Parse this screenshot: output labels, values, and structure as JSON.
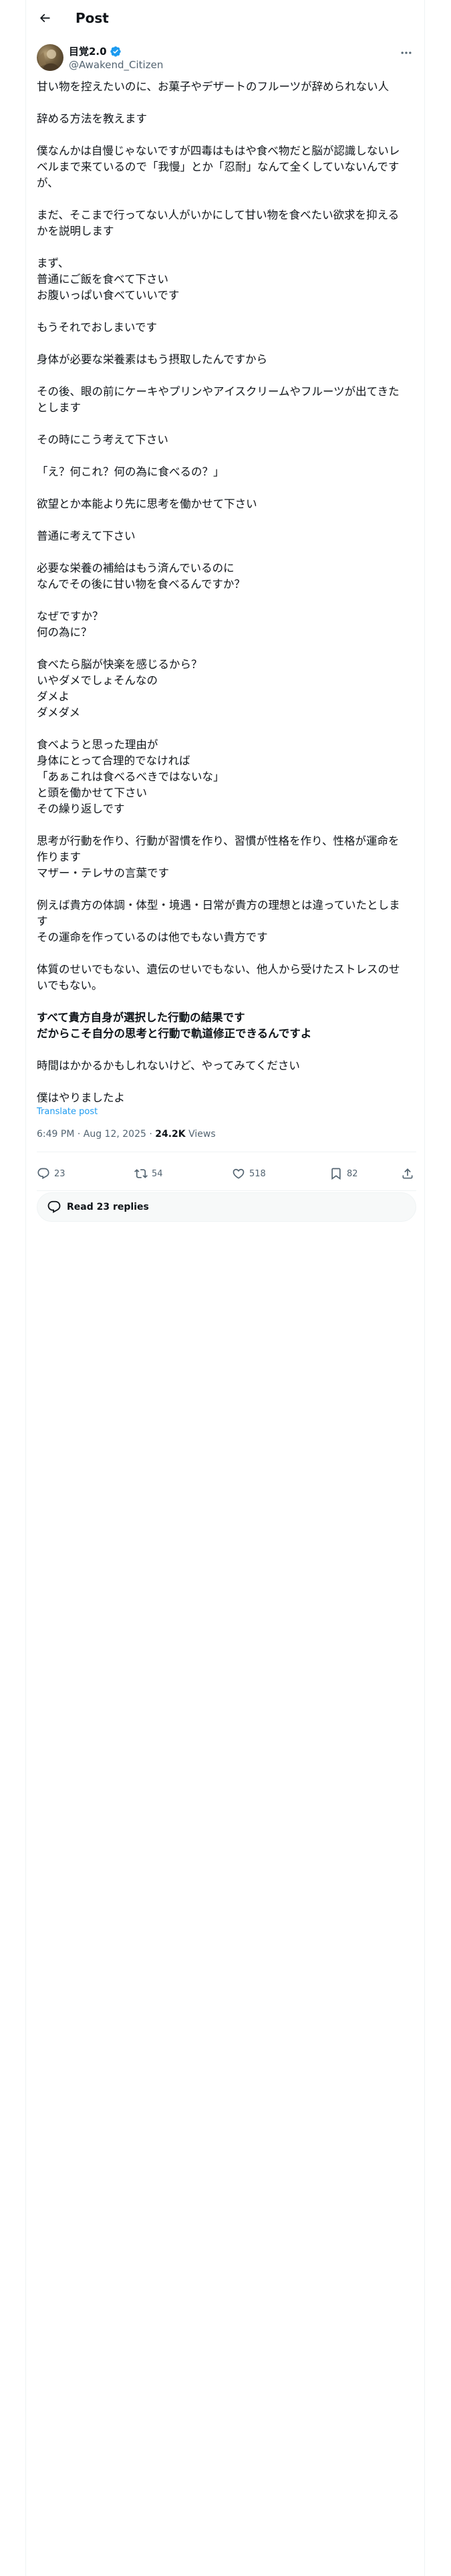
{
  "header": {
    "title": "Post"
  },
  "author": {
    "name": "目覚2.0",
    "handle": "@Awakend_Citizen"
  },
  "post": {
    "paragraphs": [
      {
        "lines": [
          "甘い物を控えたいのに、お菓子やデザートのフルーツが辞められない人"
        ]
      },
      {
        "lines": [
          "辞める方法を教えます"
        ]
      },
      {
        "lines": [
          "僕なんかは自慢じゃないですが四毒はもはや食べ物だと脳が認識しないレ",
          "ベルまで来ているので「我慢」とか「忍耐」なんて全くしていないんです",
          "が、"
        ]
      },
      {
        "lines": [
          "まだ、そこまで行ってない人がいかにして甘い物を食べたい欲求を抑える",
          "かを説明します"
        ]
      },
      {
        "lines": [
          "まず、",
          "普通にご飯を食べて下さい",
          "お腹いっぱい食べていいです"
        ]
      },
      {
        "lines": [
          "もうそれでおしまいです"
        ]
      },
      {
        "lines": [
          "身体が必要な栄養素はもう摂取したんですから"
        ]
      },
      {
        "lines": [
          "その後、眼の前にケーキやプリンやアイスクリームやフルーツが出てきた",
          "とします"
        ]
      },
      {
        "lines": [
          "その時にこう考えて下さい"
        ]
      },
      {
        "lines": [
          "「え？何これ？何の為に食べるの？」"
        ]
      },
      {
        "lines": [
          "欲望とか本能より先に思考を働かせて下さい"
        ]
      },
      {
        "lines": [
          "普通に考えて下さい"
        ]
      },
      {
        "lines": [
          "必要な栄養の補給はもう済んでいるのに",
          "なんでその後に甘い物を食べるんですか？"
        ]
      },
      {
        "lines": [
          "なぜですか？",
          "何の為に？"
        ]
      },
      {
        "lines": [
          "食べたら脳が快楽を感じるから？",
          "いやダメでしょそんなの",
          "ダメよ",
          "ダメダメ"
        ]
      },
      {
        "lines": [
          "食べようと思った理由が",
          "身体にとって合理的でなければ",
          "「あぁこれは食べるべきではないな」",
          "と頭を働かせて下さい",
          "その繰り返しです"
        ]
      },
      {
        "lines": [
          "思考が行動を作り、行動が習慣を作り、習慣が性格を作り、性格が運命を",
          "作ります",
          "マザー・テレサの言葉です"
        ]
      },
      {
        "lines": [
          "例えば貴方の体調・体型・境遇・日常が貴方の理想とは違っていたとしま",
          "す",
          "その運命を作っているのは他でもない貴方です"
        ]
      },
      {
        "lines": [
          "体質のせいでもない、遺伝のせいでもない、他人から受けたストレスのせ",
          "いでもない。"
        ]
      },
      {
        "lines": [
          "すべて貴方自身が選択した行動の結果です",
          "だからこそ自分の思考と行動で軌道修正できるんですよ"
        ],
        "bold": true
      },
      {
        "lines": [
          "時間はかかるかもしれないけど、やってみてください"
        ]
      },
      {
        "lines": [
          "僕はやりましたよ"
        ]
      }
    ],
    "translate_label": "Translate post",
    "time": "6:49 PM · Aug 12, 2025 · ",
    "views_count": "24.2K",
    "views_label": " Views"
  },
  "actions": {
    "replies": "23",
    "reposts": "54",
    "likes": "518",
    "bookmarks": "82"
  },
  "read_replies_label": "Read 23 replies",
  "colors": {
    "accent": "#1d9bf0",
    "muted": "#536471",
    "text": "#0f1419",
    "border": "#eff3f4"
  }
}
